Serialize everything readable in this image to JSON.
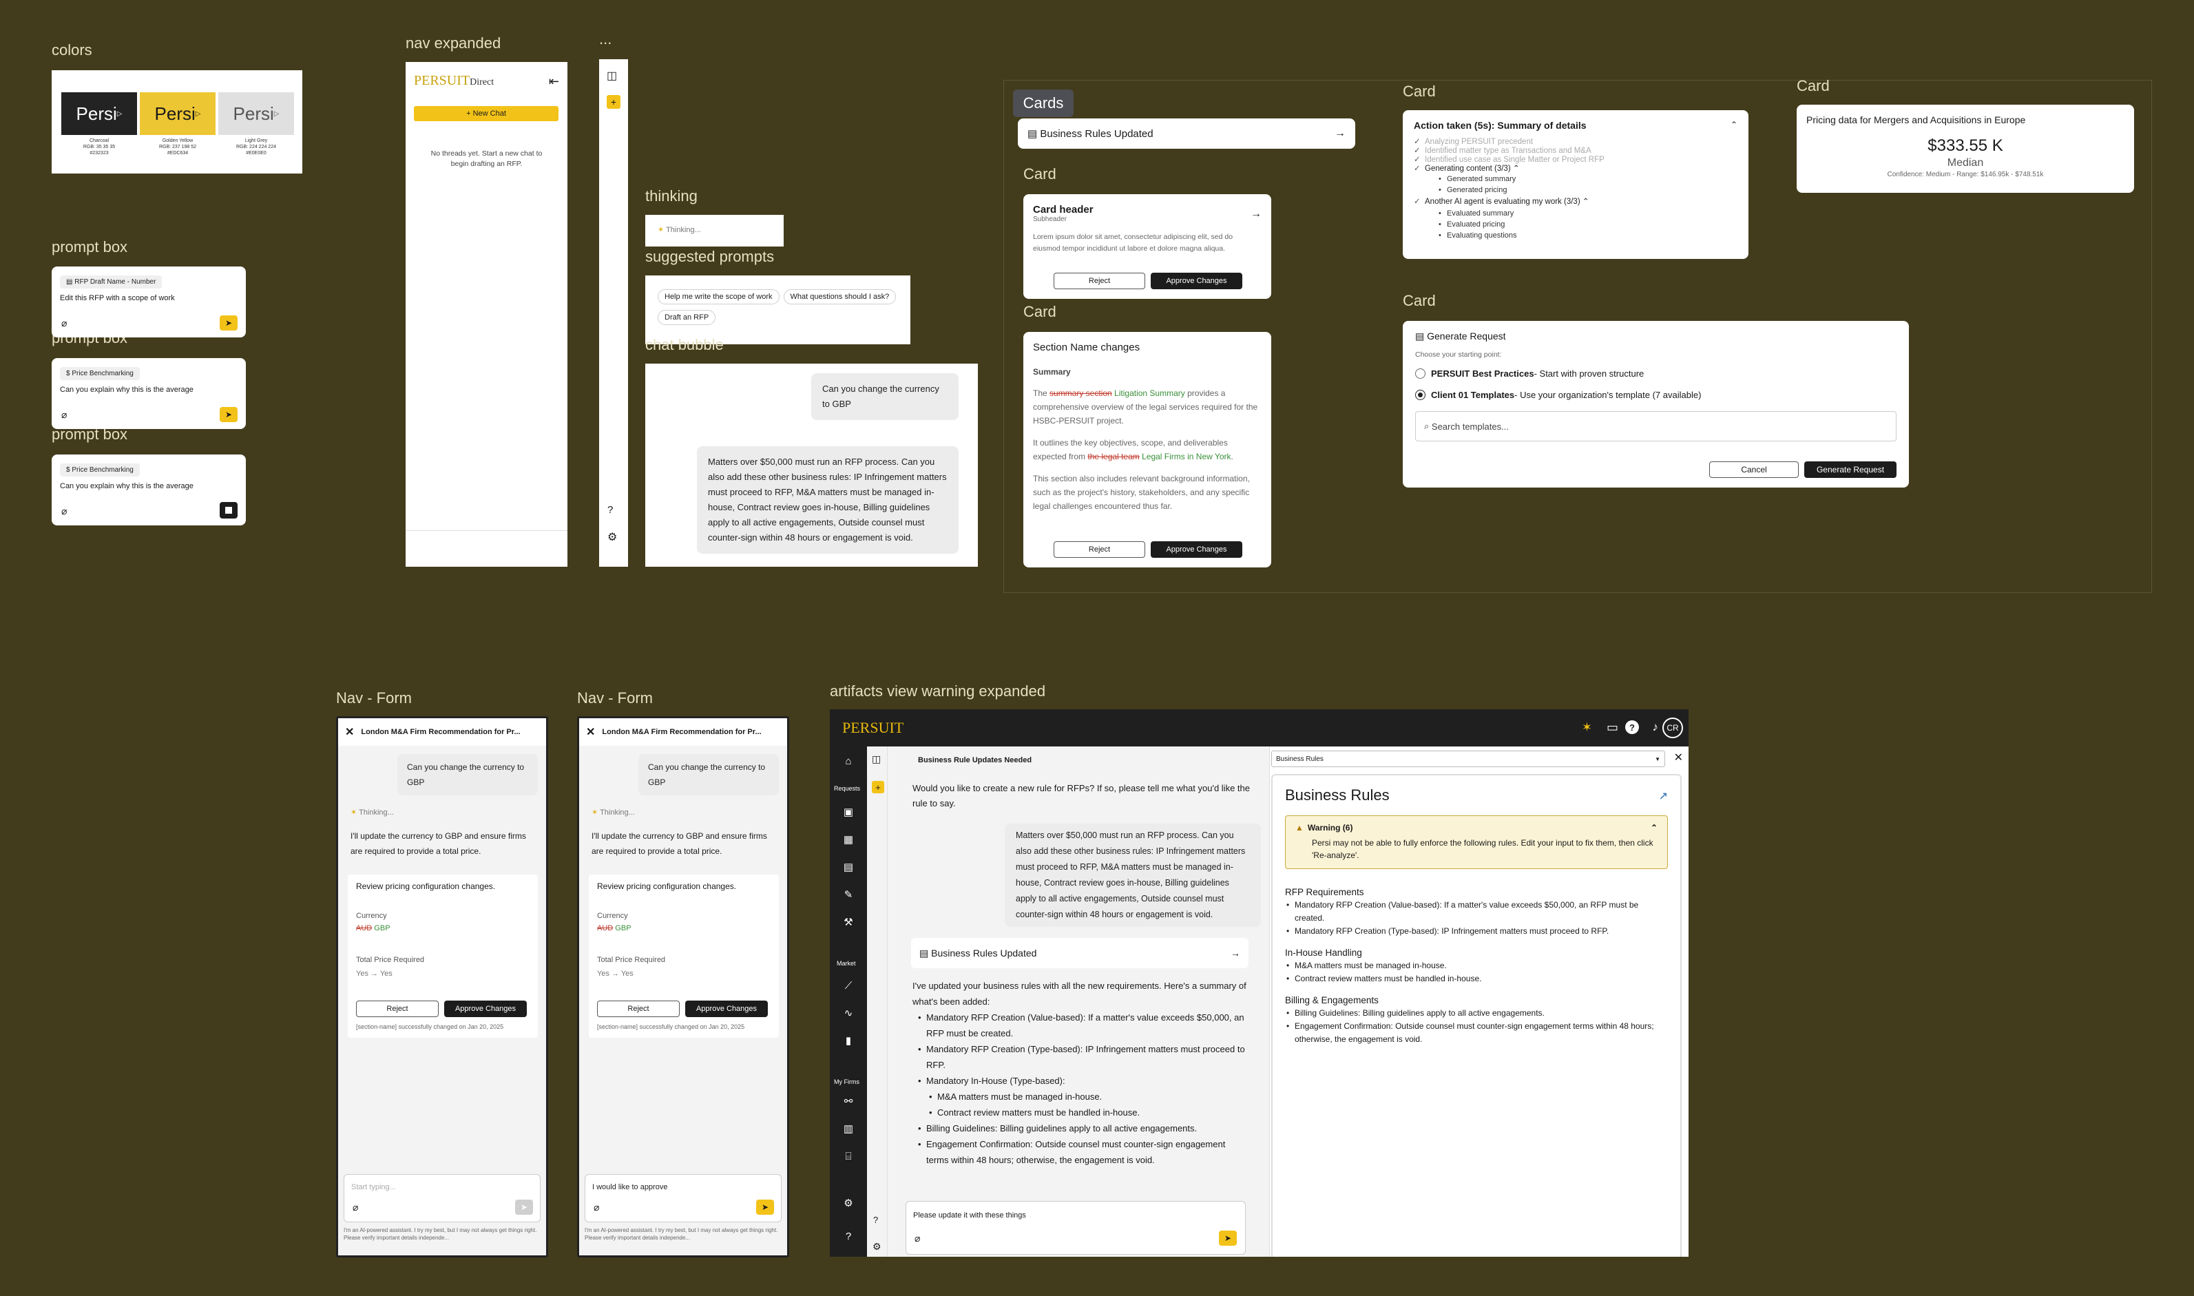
{
  "sections": {
    "colors": "colors",
    "prompt_box": "prompt box",
    "nav_expanded": "nav expanded",
    "collapsed": "...",
    "thinking": "thinking",
    "suggested_prompts": "suggested prompts",
    "chat_bubble": "chat bubble",
    "cards_badge": "Cards",
    "card": "Card",
    "nav_form": "Nav - Form",
    "artifacts": "artifacts view warning expanded"
  },
  "swatches": [
    {
      "word": "Persi",
      "name": "Charcoal",
      "meta1": "RGB: 35 35 35",
      "meta2": "#232323",
      "bg": "#232323",
      "fg": "#ffffff"
    },
    {
      "word": "Persi",
      "name": "Golden Yellow",
      "meta1": "RGB: 237 198 52",
      "meta2": "#EDC634",
      "bg": "#EDC634",
      "fg": "#1a1a1a"
    },
    {
      "word": "Persi",
      "name": "Light Grey",
      "meta1": "RGB: 224 224 224",
      "meta2": "#E0E0E0",
      "bg": "#E0E0E0",
      "fg": "#555555"
    }
  ],
  "prompts": [
    {
      "chip": "RFP Draft Name - Number",
      "text": "Edit this RFP with a scope of work"
    },
    {
      "chip": "Price Benchmarking",
      "text": "Can you explain why this is the average"
    },
    {
      "chip": "Price Benchmarking",
      "text": "Can you explain why this is the average"
    }
  ],
  "nav_expanded": {
    "logo": "PERSUIT",
    "logo_sub": "Direct",
    "new_chat": "+ New Chat",
    "empty": "No threads yet. Start a new chat to begin drafting an RFP."
  },
  "thinking_text": "Thinking...",
  "suggested": [
    "Help me write the scope of work",
    "What questions should I ask?",
    "Draft an RFP"
  ],
  "chat": {
    "user": "Can you change the currency to GBP",
    "reply": "Matters over $50,000 must run an RFP process. Can you also add these other business rules: IP Infringement matters must proceed to RFP, M&A matters must be managed in-house, Contract review goes in-house, Billing guidelines apply to all active engagements, Outside counsel must counter-sign within 48 hours or engagement is void."
  },
  "card_rules": {
    "title": "Business Rules Updated"
  },
  "card_header": {
    "title": "Card header",
    "sub": "Subheader",
    "body": "Lorem ipsum dolor sit amet, consectetur adipiscing elit, sed do eiusmod tempor incididunt ut labore et dolore magna aliqua.",
    "reject": "Reject",
    "approve": "Approve Changes"
  },
  "card_section": {
    "title": "Section Name changes",
    "label": "Summary",
    "p1_a": "The ",
    "p1_del": "summary section",
    "p1_ins": " Litigation Summary",
    "p1_b": " provides a comprehensive overview of the legal services required for the HSBC-PERSUIT project.",
    "p2_a": "It outlines the key objectives, scope, and deliverables expected from ",
    "p2_del": "the legal team",
    "p2_ins": " Legal Firms in New York.",
    "p3": "This section also includes relevant background information, such as the project's history, stakeholders, and any specific legal challenges encountered thus far.",
    "reject": "Reject",
    "approve": "Approve Changes"
  },
  "card_action": {
    "title": "Action taken (5s): Summary of details",
    "steps": [
      "Analyzing PERSUIT precedent",
      "Identified matter type as Transactions and M&A",
      "Identified use case as Single Matter or Project RFP"
    ],
    "gen": "Generating content (3/3)",
    "gen_items": [
      "Generated summary",
      "Generated pricing"
    ],
    "agent": "Another AI agent is evaluating my work (3/3)",
    "agent_items": [
      "Evaluated summary",
      "Evaluated pricing",
      "Evaluating questions"
    ]
  },
  "card_price": {
    "title": "Pricing data for Mergers and Acquisitions in Europe",
    "value": "$333.55 K",
    "label": "Median",
    "meta": "Confidence: Medium - Range: $146.95k - $748.51k"
  },
  "card_generate": {
    "title": "Generate Request",
    "choose": "Choose your starting point:",
    "opt1_b": "PERSUIT Best Practices",
    "opt1": " - Start with proven structure",
    "opt2_b": "Client 01 Templates",
    "opt2": " - Use your organization's template (7 available)",
    "search": "Search templates...",
    "cancel": "Cancel",
    "go": "Generate Request"
  },
  "form": {
    "title": "London M&A Firm Recommendation for Pr...",
    "user": "Can you change the currency to GBP",
    "thinking": "Thinking...",
    "reply": "I'll update the currency to GBP and ensure firms are required to provide a total price.",
    "review": "Review pricing configuration changes.",
    "cur_label": "Currency",
    "cur_old": "AUD",
    "cur_new": "GBP",
    "tp_label": "Total Price Required",
    "tp_val": "Yes → Yes",
    "reject": "Reject",
    "approve": "Approve Changes",
    "success": "[section-name] successfully changed on Jan 20, 2025",
    "placeholder1": "Start typing...",
    "input2": "I would like to approve",
    "disclaimer": "I'm an AI-powered assistant. I try my best, but I may not always get things right. Please verify important details independe..."
  },
  "app": {
    "logo": "PERSUIT",
    "avatar": "CR",
    "nav_requests": "Requests",
    "nav_market": "Market",
    "nav_myfirms": "My Firms",
    "chat_title": "Business Rule Updates Needed",
    "msg1": "Would you like to create a new rule for RFPs? If so, please tell me what you'd like the rule to say.",
    "user_msg": "Matters over $50,000 must run an RFP process. Can you also add these other business rules: IP Infringement matters must proceed to RFP, M&A matters must be managed in-house, Contract review goes in-house, Billing guidelines apply to all active engagements, Outside counsel must counter-sign within 48 hours or engagement is void.",
    "card": "Business Rules Updated",
    "summary_intro": "I've updated your business rules with all the new requirements. Here's a summary of what's been added:",
    "summary": [
      "Mandatory RFP Creation (Value-based): If a matter's value exceeds $50,000, an RFP must be created.",
      "Mandatory RFP Creation (Type-based): IP Infringement matters must proceed to RFP.",
      "Mandatory In-House (Type-based):"
    ],
    "summary_sub": [
      "M&A matters must be managed in-house.",
      "Contract review matters must be handled in-house."
    ],
    "summary2": [
      "Billing Guidelines: Billing guidelines apply to all active engagements.",
      "Engagement Confirmation: Outside counsel must counter-sign engagement terms within 48 hours; otherwise, the engagement is void."
    ],
    "input": "Please update it with these things",
    "select": "Business Rules",
    "rules_title": "Business Rules",
    "warn_title": "Warning (6)",
    "warn_body": "Persi may not be able to fully enforce the following rules. Edit your input to fix them, then click 'Re-analyze'.",
    "h_rfp": "RFP Requirements",
    "rfp": [
      "Mandatory RFP Creation (Value-based): If a matter's value exceeds $50,000, an RFP must be created.",
      "Mandatory RFP Creation (Type-based): IP Infringement matters must proceed to RFP."
    ],
    "h_inhouse": "In-House Handling",
    "inhouse": [
      "M&A matters must be managed in-house.",
      "Contract review matters must be handled in-house."
    ],
    "h_billing": "Billing & Engagements",
    "billing": [
      "Billing Guidelines: Billing guidelines apply to all active engagements.",
      "Engagement Confirmation: Outside counsel must counter-sign engagement terms within 48 hours; otherwise, the engagement is void."
    ]
  }
}
